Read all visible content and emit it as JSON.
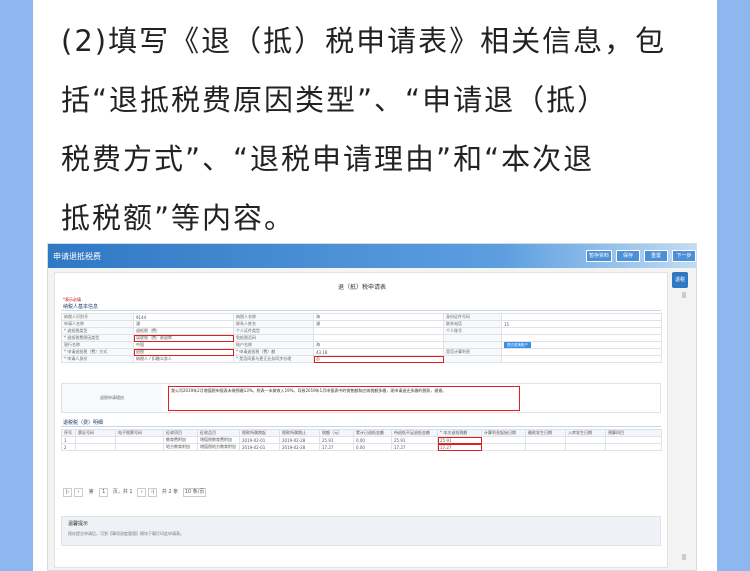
{
  "instruction": {
    "lines": [
      "(2)填写《退（抵）税申请表》相关信息，包",
      "括“退抵税费原因类型”、“申请退（抵）",
      "税费方式”、“退税申请理由”和“本次退",
      "抵税额”等内容。"
    ]
  },
  "colors": {
    "side_bar": "#8db7ee",
    "header": "#2f78c4",
    "highlight": "#e02020"
  },
  "app": {
    "title": "申请退抵税费",
    "header_buttons": [
      "暂存资料",
      "保存",
      "重置",
      "下一步"
    ],
    "side_button": "退税",
    "form_title": "退（抵）税申请表",
    "required_note": "*表示必填",
    "section_basic": "纳税人基本信息",
    "basic_rows": [
      [
        "纳税人识别号",
        "9144",
        "纳税人名称",
        "海",
        "身份证件号码",
        ""
      ],
      [
        "申请人名称",
        "潘",
        "联系人姓名",
        "潘",
        "联系电话",
        "15"
      ],
      [
        "* 退抵税类型",
        "退抵税（费）",
        "个人证件类型",
        "",
        "个人账号",
        ""
      ],
      [
        "* 退抵税费原因类型",
        "误收税（费）款退库",
        "免抵税否码",
        "",
        "",
        ""
      ],
      [
        "银行名称",
        "中国",
        "账户名称",
        "海",
        "",
        "提交更换账户"
      ],
      [
        "* 申请退抵税（费）方式",
        "退税",
        "* 申请退抵税（费）额",
        "43.18",
        "是否计算利息",
        ""
      ],
      [
        "* 申请人身份",
        "纳税人 / 扣缴义务人",
        "* 是否同意与更正业务同步办理",
        "否",
        "",
        ""
      ]
    ],
    "reason_label": "退税申请理由",
    "reason_text": "我公司2019年2月增值税申报表未做预缴13%，附表一未做收入19%，导致2019年1月申报表中的销售额和应纳税额多缴，现申请退还多缴的税款，谢谢。",
    "section_detail": "退税税（费）明细",
    "detail_headers": [
      "序号",
      "票证号码",
      "电子税票号码",
      "征收项目",
      "征收品目",
      "税款所属期起",
      "税款所属期止",
      "税额（元）",
      "累计已退抵金额",
      "待退抵不足退抵金额",
      "* 本次退抵税额",
      "计算利息起始日期",
      "缴款发生日期",
      "入库发生日期",
      "预算科目"
    ],
    "detail_rows": [
      [
        "1",
        "",
        "",
        "教育费附加",
        "增值税教育费附加",
        "2019-02-01",
        "2019-02-28",
        "25.91",
        "0.00",
        "25.91",
        "25.91",
        "",
        "",
        "",
        ""
      ],
      [
        "2",
        "",
        "",
        "地方教育附加",
        "增值税地方教育附加",
        "2019-02-01",
        "2019-02-28",
        "17.27",
        "0.00",
        "17.27",
        "17.27",
        "",
        "",
        "",
        ""
      ]
    ],
    "pager": {
      "page_label": "第",
      "current_page": "1",
      "total_label": "页，共 1",
      "range_label": "共 2 条",
      "per_page": "10 条/页"
    },
    "tips_title": "温馨提示",
    "tips_text": "保存提交申请后，可到【事项进度管理】模块下载打印此申请表。"
  }
}
